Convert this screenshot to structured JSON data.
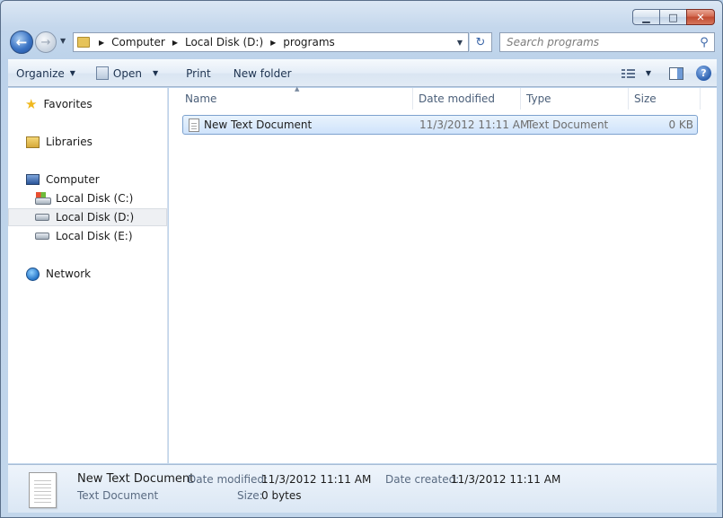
{
  "window": {
    "caption_buttons": {
      "minimize": "▁",
      "maximize": "□",
      "close": "✕"
    }
  },
  "addressbar": {
    "back_icon": "back-arrow-icon",
    "forward_icon": "forward-arrow-icon",
    "crumbs": [
      "Computer",
      "Local Disk (D:)",
      "programs"
    ],
    "search_placeholder": "Search programs"
  },
  "toolbar": {
    "organize": "Organize",
    "open": "Open",
    "print": "Print",
    "new_folder": "New folder"
  },
  "nav": {
    "favorites": "Favorites",
    "libraries": "Libraries",
    "computer": "Computer",
    "drive_c": "Local Disk (C:)",
    "drive_d": "Local Disk (D:)",
    "drive_e": "Local Disk (E:)",
    "network": "Network"
  },
  "columns": {
    "name": "Name",
    "date_modified": "Date modified",
    "type": "Type",
    "size": "Size"
  },
  "files": [
    {
      "name": "New Text Document",
      "date_modified": "11/3/2012 11:11 AM",
      "type": "Text Document",
      "size": "0 KB"
    }
  ],
  "details": {
    "name": "New Text Document",
    "type": "Text Document",
    "date_modified_label": "Date modified:",
    "date_modified": "11/3/2012 11:11 AM",
    "date_created_label": "Date created:",
    "date_created": "11/3/2012 11:11 AM",
    "size_label": "Size:",
    "size": "0 bytes"
  }
}
